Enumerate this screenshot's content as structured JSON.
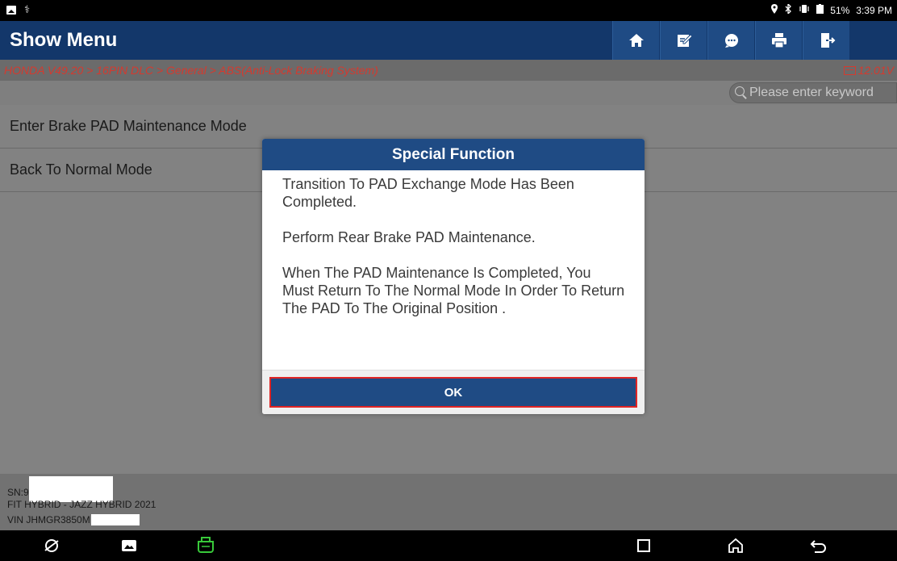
{
  "status_bar": {
    "battery": "51%",
    "time": "3:39 PM"
  },
  "header": {
    "title": "Show Menu",
    "buttons": [
      "home-icon",
      "edit-icon",
      "chat-icon",
      "print-icon",
      "exit-icon"
    ]
  },
  "breadcrumb": {
    "path": "HONDA V49.20 > 16PIN DLC > General > ABS(Anti-Lock Braking System)",
    "voltage": "12.01V"
  },
  "search": {
    "placeholder": "Please enter keyword"
  },
  "menu": {
    "items": [
      {
        "label": "Enter Brake PAD Maintenance Mode"
      },
      {
        "label": "Back To Normal Mode"
      }
    ]
  },
  "footer": {
    "sn": "SN:9",
    "model": "FIT HYBRID - JAZZ HYBRID 2021",
    "vin": "VIN JHMGR3850M"
  },
  "dialog": {
    "title": "Special Function",
    "paragraphs": [
      "Transition To PAD Exchange Mode Has Been Completed.",
      "Perform Rear Brake PAD Maintenance.",
      "When The PAD Maintenance Is Completed, You Must Return To The Normal Mode In Order To Return The PAD To The Original Position ."
    ],
    "ok_label": "OK"
  },
  "colors": {
    "header_bg": "#13376a",
    "button_bg": "#1f4b84",
    "breadcrumb_text": "#d43a2f",
    "ok_border": "#e02424",
    "vci_icon": "#38c93a"
  }
}
